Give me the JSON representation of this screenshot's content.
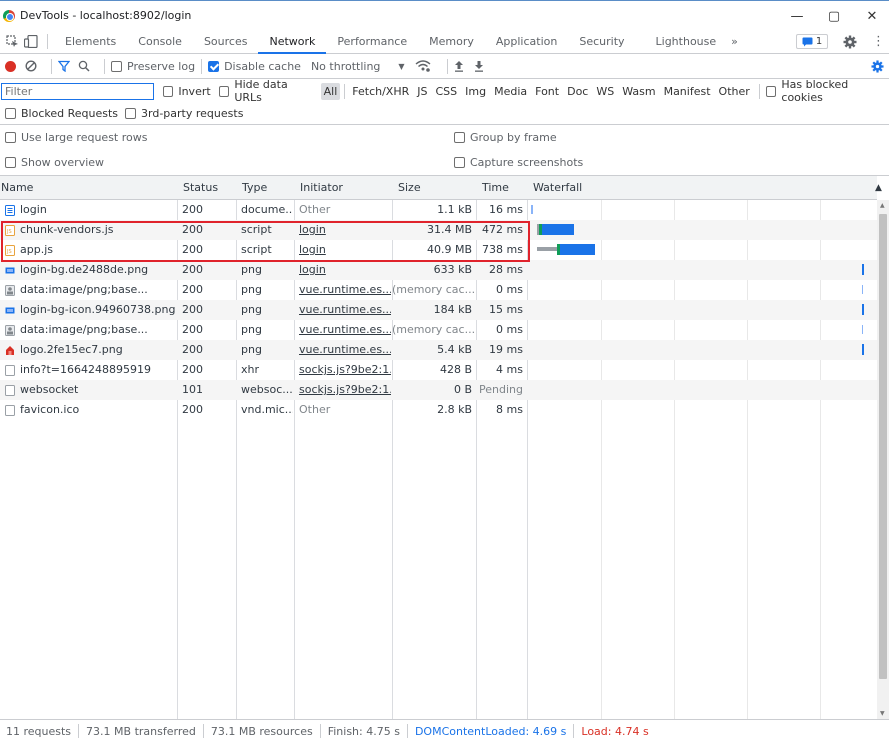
{
  "window": {
    "title": "DevTools - localhost:8902/login",
    "controls": [
      "—",
      "▢",
      "✕"
    ]
  },
  "tabs": [
    {
      "label": "Elements",
      "active": false
    },
    {
      "label": "Console",
      "active": false
    },
    {
      "label": "Sources",
      "active": false
    },
    {
      "label": "Network",
      "active": true
    },
    {
      "label": "Performance",
      "active": false
    },
    {
      "label": "Memory",
      "active": false
    },
    {
      "label": "Application",
      "active": false
    },
    {
      "label": "Security",
      "active": false
    },
    {
      "label": "Lighthouse",
      "active": false
    }
  ],
  "tabs_more": "»",
  "issues_badge": "1",
  "toolbar": {
    "preserve_log_label": "Preserve log",
    "preserve_log_checked": false,
    "disable_cache_label": "Disable cache",
    "disable_cache_checked": true,
    "throttling": "No throttling"
  },
  "filter": {
    "placeholder": "Filter",
    "invert_label": "Invert",
    "hide_data_urls_label": "Hide data URLs",
    "types": [
      "All",
      "Fetch/XHR",
      "JS",
      "CSS",
      "Img",
      "Media",
      "Font",
      "Doc",
      "WS",
      "Wasm",
      "Manifest",
      "Other"
    ],
    "active_type": "All",
    "has_blocked_cookies_label": "Has blocked cookies",
    "blocked_requests_label": "Blocked Requests",
    "third_party_label": "3rd-party requests"
  },
  "settings": {
    "large_rows_label": "Use large request rows",
    "group_by_frame_label": "Group by frame",
    "show_overview_label": "Show overview",
    "capture_screenshots_label": "Capture screenshots"
  },
  "columns": {
    "name": "Name",
    "status": "Status",
    "type": "Type",
    "initiator": "Initiator",
    "size": "Size",
    "time": "Time",
    "waterfall": "Waterfall"
  },
  "requests": [
    {
      "name": "login",
      "icon": "document",
      "status": "200",
      "type": "docume...",
      "initiator": "Other",
      "initiator_link": false,
      "size": "1.1 kB",
      "time": "16 ms"
    },
    {
      "name": "chunk-vendors.js",
      "icon": "script",
      "status": "200",
      "type": "script",
      "initiator": "login",
      "initiator_link": true,
      "size": "31.4 MB",
      "time": "472 ms"
    },
    {
      "name": "app.js",
      "icon": "script",
      "status": "200",
      "type": "script",
      "initiator": "login",
      "initiator_link": true,
      "size": "40.9 MB",
      "time": "738 ms"
    },
    {
      "name": "login-bg.de2488de.png",
      "icon": "image-blue",
      "status": "200",
      "type": "png",
      "initiator": "login",
      "initiator_link": true,
      "size": "633 kB",
      "time": "28 ms"
    },
    {
      "name": "data:image/png;base...",
      "icon": "image-gray",
      "status": "200",
      "type": "png",
      "initiator": "vue.runtime.es...",
      "initiator_link": true,
      "size": "(memory cac...",
      "time": "0 ms"
    },
    {
      "name": "login-bg-icon.94960738.png",
      "icon": "image-blue",
      "status": "200",
      "type": "png",
      "initiator": "vue.runtime.es...",
      "initiator_link": true,
      "size": "184 kB",
      "time": "15 ms"
    },
    {
      "name": "data:image/png;base...",
      "icon": "image-gray",
      "status": "200",
      "type": "png",
      "initiator": "vue.runtime.es...",
      "initiator_link": true,
      "size": "(memory cac...",
      "time": "0 ms"
    },
    {
      "name": "logo.2fe15ec7.png",
      "icon": "image-red",
      "status": "200",
      "type": "png",
      "initiator": "vue.runtime.es...",
      "initiator_link": true,
      "size": "5.4 kB",
      "time": "19 ms"
    },
    {
      "name": "info?t=1664248895919",
      "icon": "blank",
      "status": "200",
      "type": "xhr",
      "initiator": "sockjs.js?9be2:1...",
      "initiator_link": true,
      "size": "428 B",
      "time": "4 ms"
    },
    {
      "name": "websocket",
      "icon": "blank",
      "status": "101",
      "type": "websoc...",
      "initiator": "sockjs.js?9be2:1...",
      "initiator_link": true,
      "size": "0 B",
      "time": "Pending"
    },
    {
      "name": "favicon.ico",
      "icon": "blank",
      "status": "200",
      "type": "vnd.mic...",
      "initiator": "Other",
      "initiator_link": false,
      "size": "2.8 kB",
      "time": "8 ms"
    }
  ],
  "colors": {
    "accent": "#1a73e8",
    "record": "#d93025",
    "highlight": "#e0232c",
    "dom_content_loaded": "#1a73e8",
    "load": "#d93025"
  },
  "status": {
    "requests": "11 requests",
    "transferred": "73.1 MB transferred",
    "resources": "73.1 MB resources",
    "finish": "Finish: 4.75 s",
    "dom_content_loaded": "DOMContentLoaded: 4.69 s",
    "load": "Load: 4.74 s"
  }
}
